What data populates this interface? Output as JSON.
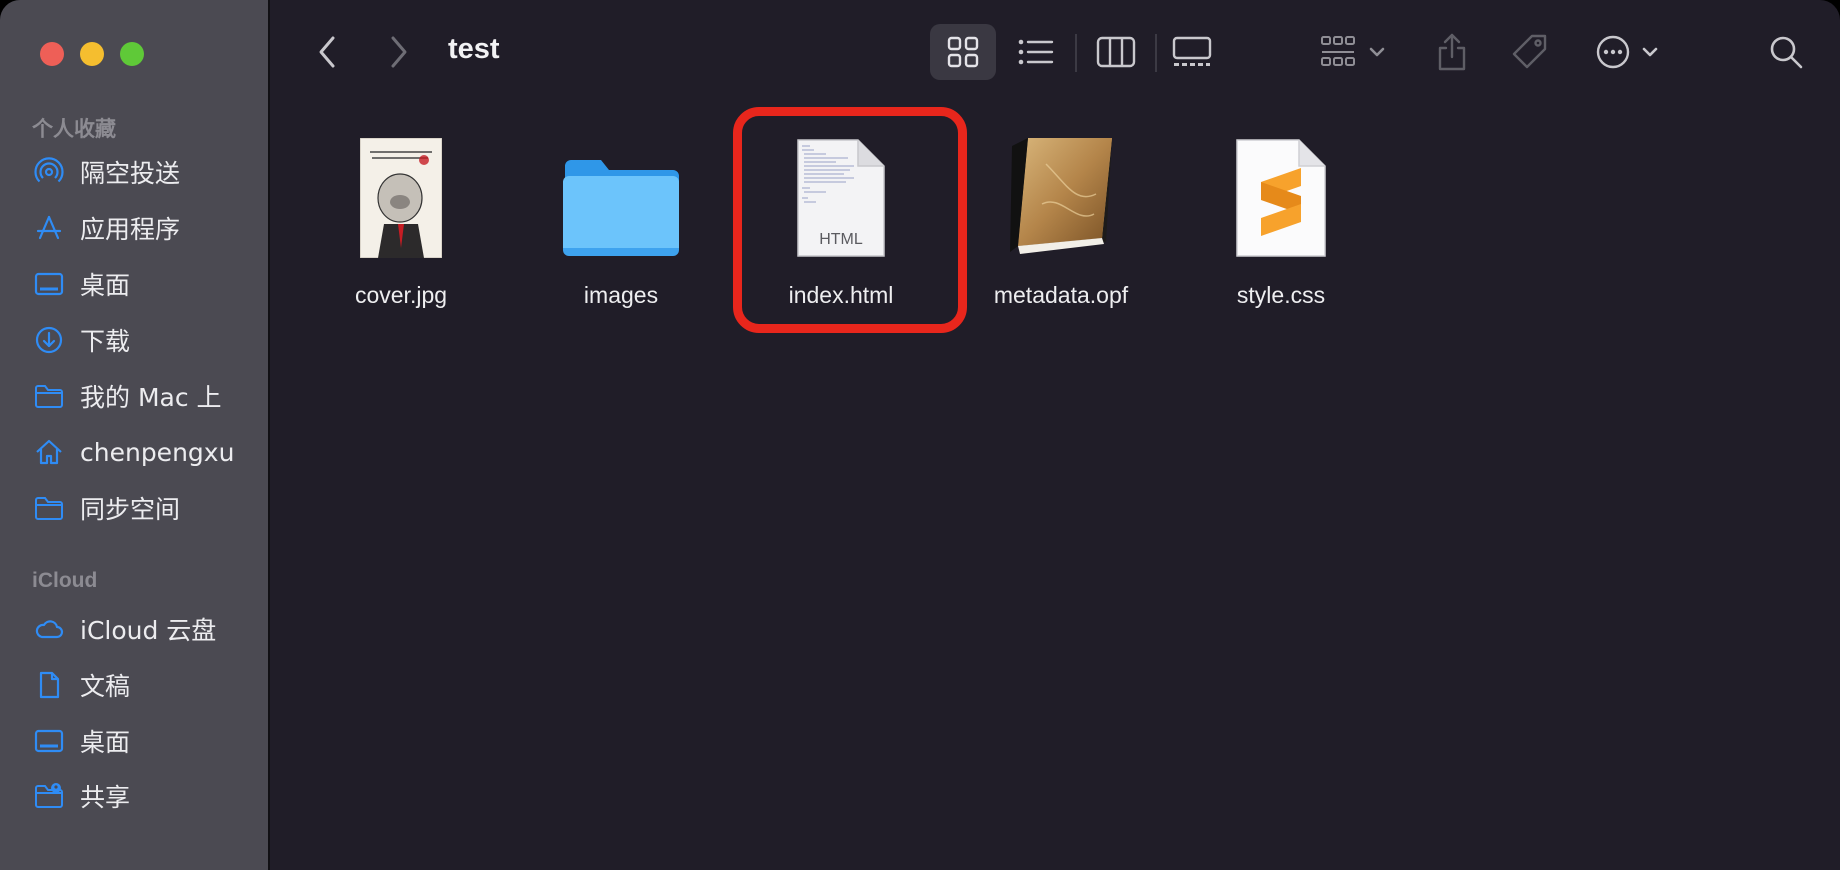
{
  "window": {
    "title": "test"
  },
  "sidebar": {
    "sections": [
      {
        "title": "个人收藏"
      },
      {
        "title": "iCloud"
      }
    ],
    "favorites": [
      {
        "label": "隔空投送",
        "icon": "airdrop-icon"
      },
      {
        "label": "应用程序",
        "icon": "applications-icon"
      },
      {
        "label": "桌面",
        "icon": "desktop-icon"
      },
      {
        "label": "下载",
        "icon": "downloads-icon"
      },
      {
        "label": "我的 Mac 上",
        "icon": "folder-icon"
      },
      {
        "label": "chenpengxu",
        "icon": "home-icon"
      },
      {
        "label": "同步空间",
        "icon": "folder-icon"
      }
    ],
    "icloud": [
      {
        "label": "iCloud 云盘",
        "icon": "cloud-icon"
      },
      {
        "label": "文稿",
        "icon": "document-icon"
      },
      {
        "label": "桌面",
        "icon": "desktop-icon"
      },
      {
        "label": "共享",
        "icon": "shared-folder-icon"
      }
    ]
  },
  "toolbar": {
    "buttons": [
      "back-icon",
      "forward-icon",
      "icon-view-icon",
      "list-view-icon",
      "column-view-icon",
      "gallery-view-icon",
      "group-icon",
      "share-icon",
      "tag-icon",
      "more-icon",
      "search-icon"
    ],
    "selected_view": "icon-view"
  },
  "files": [
    {
      "name": "cover.jpg",
      "icon": "image-thumbnail-icon"
    },
    {
      "name": "images",
      "icon": "folder-icon"
    },
    {
      "name": "index.html",
      "icon": "html-file-icon",
      "badge": "HTML"
    },
    {
      "name": "metadata.opf",
      "icon": "ebook-icon"
    },
    {
      "name": "style.css",
      "icon": "sublime-text-icon"
    }
  ],
  "colors": {
    "accent": "#2f8cf5",
    "highlight": "#e8261c",
    "sidebar": "#4b4a52",
    "content": "#201d28"
  }
}
